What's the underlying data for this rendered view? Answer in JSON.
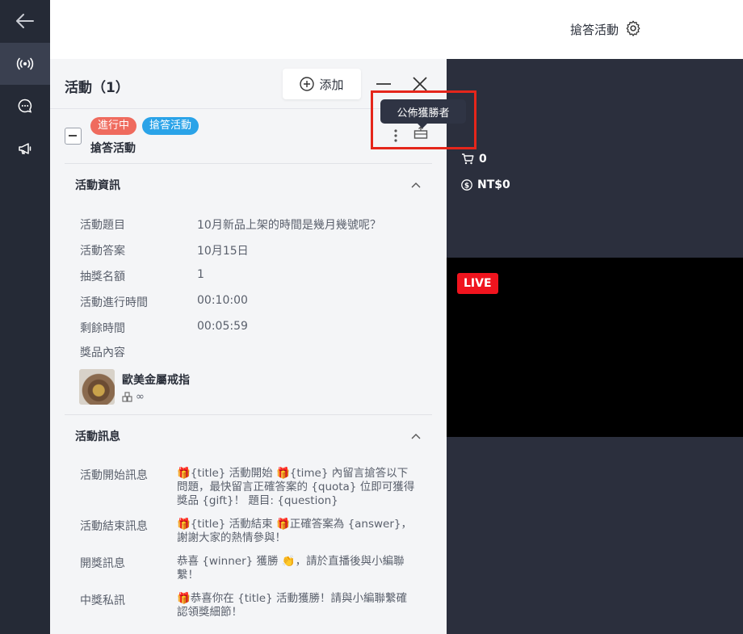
{
  "header": {
    "title": "搶答活動",
    "settings_icon": "gear-icon"
  },
  "rail": {
    "items": [
      "back-arrow-icon",
      "live-broadcast-icon",
      "chat-icon",
      "megaphone-icon"
    ]
  },
  "panel": {
    "title": "活動（1）",
    "add_label": "添加",
    "activity": {
      "status": "進行中",
      "type": "搶答活動",
      "name": "搶答活動"
    },
    "tooltip": "公佈獲勝者",
    "info_section": {
      "title": "活動資訊",
      "rows": [
        {
          "label": "活動題目",
          "value": "10月新品上架的時間是幾月幾號呢？"
        },
        {
          "label": "活動答案",
          "value": "10月15日"
        },
        {
          "label": "抽獎名額",
          "value": "1"
        },
        {
          "label": "活動進行時間",
          "value": "00:10:00"
        },
        {
          "label": "剩餘時間",
          "value": "00:05:59"
        }
      ],
      "prize_label": "獎品內容",
      "prize_name": "歐美金屬戒指",
      "prize_qty": "∞"
    },
    "message_section": {
      "title": "活動訊息",
      "rows": [
        {
          "label": "活動開始訊息",
          "value": "🎁{title} 活動開始 🎁{time} 內留言搶答以下問題，最快留言正確答案的 {quota} 位即可獲得獎品 {gift}！ 題目: {question}"
        },
        {
          "label": "活動結束訊息",
          "value": "🎁{title} 活動結束 🎁正確答案為 {answer}，謝謝大家的熱情參與！"
        },
        {
          "label": "開獎訊息",
          "value": "恭喜 {winner} 獲勝 👏，請於直播後與小編聯繫！"
        },
        {
          "label": "中獎私訊",
          "value": "🎁恭喜你在 {title} 活動獲勝！請與小編聯繫確認領獎細節！"
        }
      ]
    }
  },
  "stage": {
    "cart_count": "0",
    "revenue": "NT$0",
    "live_label": "LIVE"
  },
  "colors": {
    "status_tag": "#ef6b5e",
    "type_tag": "#2aa3e8",
    "live_red": "#f0141e",
    "highlight": "#e5261b",
    "rail": "#252a36",
    "stage": "#2b2f3d"
  }
}
